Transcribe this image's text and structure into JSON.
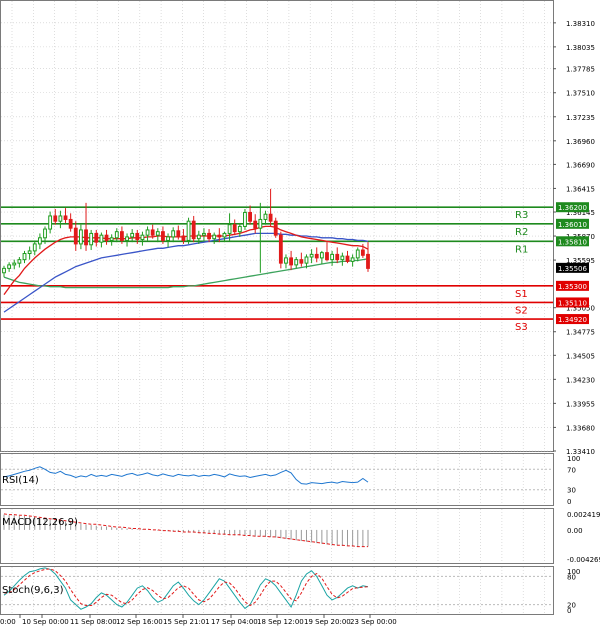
{
  "chart_data": [
    {
      "type": "candlestick",
      "pane": "main",
      "ylim": [
        1.3341,
        1.3856
      ],
      "y_ticks": [
        "1.38310",
        "1.38035",
        "1.37785",
        "1.37510",
        "1.37235",
        "1.36960",
        "1.36690",
        "1.36415",
        "1.36145",
        "1.35870",
        "1.35595",
        "1.35050",
        "1.34775",
        "1.34505",
        "1.34230",
        "1.33955",
        "1.33680",
        "1.33410"
      ],
      "current_price": "1.35506",
      "levels": [
        {
          "label": "R3",
          "value": 1.362,
          "text": "1.36200",
          "color": "#1e8a1e"
        },
        {
          "label": "R2",
          "value": 1.3601,
          "text": "1.36010",
          "color": "#1e8a1e"
        },
        {
          "label": "R1",
          "value": 1.3581,
          "text": "1.35810",
          "color": "#1e8a1e"
        },
        {
          "label": "S1",
          "value": 1.353,
          "text": "1.35300",
          "color": "#e00000"
        },
        {
          "label": "S2",
          "value": 1.3511,
          "text": "1.35110",
          "color": "#e00000"
        },
        {
          "label": "S3",
          "value": 1.3492,
          "text": "1.34920",
          "color": "#e00000"
        }
      ],
      "candles": [
        [
          1.3545,
          1.3553,
          1.354,
          1.355
        ],
        [
          1.355,
          1.3557,
          1.3546,
          1.3554
        ],
        [
          1.3554,
          1.356,
          1.3549,
          1.3556
        ],
        [
          1.3556,
          1.3563,
          1.3551,
          1.356
        ],
        [
          1.356,
          1.357,
          1.3556,
          1.3567
        ],
        [
          1.3567,
          1.3575,
          1.356,
          1.357
        ],
        [
          1.357,
          1.3582,
          1.3565,
          1.3578
        ],
        [
          1.3578,
          1.359,
          1.3572,
          1.3585
        ],
        [
          1.3585,
          1.3598,
          1.3578,
          1.3595
        ],
        [
          1.3595,
          1.3615,
          1.359,
          1.361
        ],
        [
          1.361,
          1.3618,
          1.36,
          1.3604
        ],
        [
          1.3604,
          1.3616,
          1.3596,
          1.361
        ],
        [
          1.361,
          1.3619,
          1.3602,
          1.3606
        ],
        [
          1.3606,
          1.3613,
          1.3592,
          1.3596
        ],
        [
          1.3596,
          1.3604,
          1.357,
          1.3578
        ],
        [
          1.3578,
          1.36,
          1.3572,
          1.3594
        ],
        [
          1.3594,
          1.3625,
          1.357,
          1.3577
        ],
        [
          1.3577,
          1.3594,
          1.3571,
          1.359
        ],
        [
          1.359,
          1.3594,
          1.3575,
          1.358
        ],
        [
          1.358,
          1.3591,
          1.3574,
          1.3588
        ],
        [
          1.3588,
          1.3594,
          1.3577,
          1.3582
        ],
        [
          1.3582,
          1.3589,
          1.3576,
          1.3585
        ],
        [
          1.3585,
          1.3596,
          1.358,
          1.3592
        ],
        [
          1.3592,
          1.3598,
          1.3578,
          1.3582
        ],
        [
          1.3582,
          1.359,
          1.3575,
          1.3586
        ],
        [
          1.3586,
          1.3595,
          1.358,
          1.359
        ],
        [
          1.359,
          1.3594,
          1.3578,
          1.3583
        ],
        [
          1.3583,
          1.3592,
          1.3576,
          1.3588
        ],
        [
          1.3588,
          1.3598,
          1.3582,
          1.3594
        ],
        [
          1.3594,
          1.36,
          1.3584,
          1.3588
        ],
        [
          1.3588,
          1.3596,
          1.358,
          1.3592
        ],
        [
          1.3592,
          1.3598,
          1.3578,
          1.3582
        ],
        [
          1.3582,
          1.359,
          1.3574,
          1.3586
        ],
        [
          1.3586,
          1.3597,
          1.358,
          1.3593
        ],
        [
          1.3593,
          1.3599,
          1.3583,
          1.3587
        ],
        [
          1.3587,
          1.3595,
          1.3578,
          1.3582
        ],
        [
          1.3582,
          1.3608,
          1.3578,
          1.3604
        ],
        [
          1.3604,
          1.361,
          1.358,
          1.3584
        ],
        [
          1.3584,
          1.3593,
          1.3578,
          1.3588
        ],
        [
          1.3588,
          1.3596,
          1.3582,
          1.359
        ],
        [
          1.359,
          1.3595,
          1.358,
          1.3584
        ],
        [
          1.3584,
          1.3591,
          1.3578,
          1.3588
        ],
        [
          1.3588,
          1.3596,
          1.358,
          1.3586
        ],
        [
          1.3586,
          1.3592,
          1.358,
          1.359
        ],
        [
          1.359,
          1.3613,
          1.3582,
          1.36
        ],
        [
          1.36,
          1.3606,
          1.3588,
          1.3592
        ],
        [
          1.3592,
          1.3602,
          1.3586,
          1.3598
        ],
        [
          1.3598,
          1.3618,
          1.3594,
          1.3614
        ],
        [
          1.3614,
          1.3622,
          1.36,
          1.3604
        ],
        [
          1.3604,
          1.3612,
          1.359,
          1.3596
        ],
        [
          1.3596,
          1.3625,
          1.3545,
          1.3606
        ],
        [
          1.3606,
          1.3616,
          1.36,
          1.3612
        ],
        [
          1.3612,
          1.3641,
          1.3598,
          1.3604
        ],
        [
          1.3604,
          1.3608,
          1.3585,
          1.3588
        ],
        [
          1.3588,
          1.3592,
          1.355,
          1.3556
        ],
        [
          1.3556,
          1.3566,
          1.355,
          1.3562
        ],
        [
          1.3562,
          1.357,
          1.3548,
          1.3554
        ],
        [
          1.3554,
          1.3563,
          1.355,
          1.356
        ],
        [
          1.356,
          1.3568,
          1.3552,
          1.3556
        ],
        [
          1.3556,
          1.3566,
          1.355,
          1.3563
        ],
        [
          1.3563,
          1.3572,
          1.3556,
          1.3566
        ],
        [
          1.3566,
          1.3574,
          1.3557,
          1.3562
        ],
        [
          1.3562,
          1.357,
          1.3555,
          1.3568
        ],
        [
          1.3568,
          1.358,
          1.3558,
          1.356
        ],
        [
          1.356,
          1.357,
          1.3553,
          1.3566
        ],
        [
          1.3566,
          1.3574,
          1.3556,
          1.356
        ],
        [
          1.356,
          1.3568,
          1.3553,
          1.3564
        ],
        [
          1.3564,
          1.357,
          1.3556,
          1.3558
        ],
        [
          1.3558,
          1.3566,
          1.3552,
          1.3562
        ],
        [
          1.3562,
          1.3574,
          1.3558,
          1.3571
        ],
        [
          1.3571,
          1.3578,
          1.3562,
          1.3565
        ],
        [
          1.3566,
          1.358,
          1.3546,
          1.355
        ]
      ],
      "ma_red": [
        1.352,
        1.3528,
        1.3536,
        1.3542,
        1.355,
        1.3556,
        1.3562,
        1.3567,
        1.3572,
        1.3576,
        1.358,
        1.3583,
        1.3585,
        1.3586,
        1.3586,
        1.3586,
        1.3585,
        1.3585,
        1.3585,
        1.3585,
        1.3584,
        1.3584,
        1.3584,
        1.3584,
        1.3584,
        1.3585,
        1.3585,
        1.3585,
        1.3586,
        1.3586,
        1.3587,
        1.3587,
        1.3586,
        1.3586,
        1.3586,
        1.3586,
        1.3587,
        1.3587,
        1.3587,
        1.3587,
        1.3587,
        1.3587,
        1.3587,
        1.3587,
        1.3588,
        1.3589,
        1.359,
        1.3592,
        1.3594,
        1.3595,
        1.3597,
        1.3598,
        1.3598,
        1.3597,
        1.3594,
        1.3592,
        1.359,
        1.3588,
        1.3586,
        1.3585,
        1.3584,
        1.3583,
        1.3582,
        1.3581,
        1.358,
        1.3579,
        1.3578,
        1.3577,
        1.3576,
        1.3576,
        1.3575,
        1.3572
      ],
      "ma_blue": [
        1.35,
        1.3504,
        1.3508,
        1.3512,
        1.3516,
        1.352,
        1.3524,
        1.3528,
        1.3532,
        1.3536,
        1.354,
        1.3543,
        1.3546,
        1.3549,
        1.3552,
        1.3554,
        1.3556,
        1.3558,
        1.356,
        1.3562,
        1.3563,
        1.3564,
        1.3565,
        1.3566,
        1.3567,
        1.3568,
        1.3569,
        1.357,
        1.3571,
        1.3572,
        1.3573,
        1.3573,
        1.3574,
        1.3575,
        1.3576,
        1.3576,
        1.3577,
        1.3578,
        1.3579,
        1.358,
        1.3581,
        1.3582,
        1.3583,
        1.3584,
        1.3585,
        1.3586,
        1.3587,
        1.3588,
        1.3589,
        1.359,
        1.359,
        1.359,
        1.359,
        1.359,
        1.3589,
        1.3589,
        1.3588,
        1.3588,
        1.3587,
        1.3587,
        1.3586,
        1.3586,
        1.3585,
        1.3585,
        1.3585,
        1.3584,
        1.3584,
        1.3583,
        1.3583,
        1.3582,
        1.3582,
        1.3581
      ],
      "ma_green": [
        1.354,
        1.3538,
        1.3536,
        1.3534,
        1.3533,
        1.3532,
        1.3531,
        1.353,
        1.353,
        1.3529,
        1.3529,
        1.3529,
        1.3528,
        1.3528,
        1.3528,
        1.3528,
        1.3528,
        1.3528,
        1.3528,
        1.3528,
        1.3528,
        1.3528,
        1.3528,
        1.3528,
        1.3528,
        1.3528,
        1.3528,
        1.3528,
        1.3528,
        1.3528,
        1.3528,
        1.3528,
        1.3528,
        1.3529,
        1.3529,
        1.3529,
        1.353,
        1.353,
        1.3531,
        1.3532,
        1.3533,
        1.3534,
        1.3535,
        1.3536,
        1.3537,
        1.3538,
        1.3539,
        1.354,
        1.3541,
        1.3542,
        1.3543,
        1.3544,
        1.3545,
        1.3546,
        1.3547,
        1.3548,
        1.3549,
        1.355,
        1.3551,
        1.3552,
        1.3553,
        1.3554,
        1.3555,
        1.3556,
        1.3557,
        1.3557,
        1.3558,
        1.3558,
        1.3559,
        1.3559,
        1.356,
        1.3561
      ]
    },
    {
      "type": "line",
      "pane": "rsi",
      "title": "RSI(14)",
      "ylim": [
        0,
        100
      ],
      "y_ticks": [
        "100",
        "70",
        "30",
        "0"
      ],
      "levels": [
        70,
        30
      ],
      "values": [
        55,
        57,
        60,
        63,
        66,
        68,
        72,
        75,
        70,
        64,
        62,
        66,
        60,
        58,
        54,
        57,
        55,
        60,
        56,
        58,
        56,
        60,
        58,
        56,
        60,
        62,
        58,
        60,
        63,
        59,
        57,
        61,
        58,
        56,
        60,
        58,
        57,
        59,
        56,
        58,
        57,
        60,
        58,
        55,
        61,
        58,
        56,
        57,
        54,
        56,
        58,
        60,
        57,
        59,
        64,
        68,
        63,
        50,
        42,
        41,
        44,
        43,
        42,
        44,
        45,
        43,
        46,
        45,
        44,
        45,
        52,
        45
      ]
    },
    {
      "type": "line",
      "pane": "macd",
      "title": "MACD(12,26,9)",
      "ylim": [
        -0.00475,
        0.003
      ],
      "y_ticks": [
        "0.002419",
        "0.00",
        "-0.004269"
      ],
      "histogram": [
        0.0022,
        0.0021,
        0.0021,
        0.002,
        0.002,
        0.0019,
        0.0018,
        0.0017,
        0.0016,
        0.0015,
        0.0014,
        0.0013,
        0.0012,
        0.0011,
        0.001,
        0.0009,
        0.0008,
        0.0007,
        0.0006,
        0.0005,
        0.0005,
        0.0004,
        0.0003,
        0.0003,
        0.0002,
        0.0002,
        0.0001,
        0.0001,
        0.0,
        0.0,
        -0.0001,
        -0.0001,
        -0.0002,
        -0.0002,
        -0.0003,
        -0.0003,
        -0.0003,
        -0.0004,
        -0.0004,
        -0.0005,
        -0.0005,
        -0.0006,
        -0.0006,
        -0.0007,
        -0.0007,
        -0.0008,
        -0.0008,
        -0.0008,
        -0.0009,
        -0.0009,
        -0.0009,
        -0.001,
        -0.001,
        -0.0011,
        -0.0012,
        -0.0013,
        -0.0014,
        -0.0015,
        -0.0016,
        -0.0017,
        -0.0018,
        -0.0019,
        -0.002,
        -0.0021,
        -0.0022,
        -0.0022,
        -0.0023,
        -0.0023,
        -0.0024,
        -0.0024,
        -0.0024,
        -0.0024
      ],
      "signal": [
        0.0023,
        0.0022,
        0.0022,
        0.0021,
        0.0021,
        0.002,
        0.0019,
        0.0018,
        0.0017,
        0.0016,
        0.0015,
        0.0014,
        0.0013,
        0.0012,
        0.0011,
        0.001,
        0.0009,
        0.0008,
        0.0008,
        0.0007,
        0.0006,
        0.0005,
        0.0004,
        0.0004,
        0.0003,
        0.0002,
        0.0002,
        0.0001,
        0.0001,
        0.0,
        0.0,
        -0.0001,
        -0.0001,
        -0.0002,
        -0.0002,
        -0.0003,
        -0.0003,
        -0.0003,
        -0.0004,
        -0.0004,
        -0.0005,
        -0.0005,
        -0.0006,
        -0.0006,
        -0.0007,
        -0.0007,
        -0.0007,
        -0.0008,
        -0.0008,
        -0.0009,
        -0.0009,
        -0.0009,
        -0.001,
        -0.001,
        -0.0011,
        -0.0012,
        -0.0013,
        -0.0014,
        -0.0015,
        -0.0016,
        -0.0017,
        -0.0018,
        -0.0019,
        -0.002,
        -0.0021,
        -0.0022,
        -0.0022,
        -0.0023,
        -0.0023,
        -0.0024,
        -0.0024,
        -0.0024
      ]
    },
    {
      "type": "line",
      "pane": "stoch",
      "title": "Stoch(9,6,3)",
      "ylim": [
        0,
        100
      ],
      "y_ticks": [
        "100",
        "80",
        "20",
        "0"
      ],
      "levels": [
        80,
        20
      ],
      "main": [
        40,
        48,
        60,
        72,
        82,
        90,
        92,
        96,
        98,
        95,
        85,
        70,
        55,
        30,
        20,
        10,
        15,
        22,
        35,
        45,
        40,
        30,
        20,
        15,
        25,
        40,
        55,
        60,
        50,
        35,
        25,
        30,
        45,
        60,
        68,
        55,
        40,
        28,
        20,
        30,
        45,
        60,
        75,
        70,
        55,
        40,
        25,
        12,
        20,
        40,
        62,
        75,
        70,
        60,
        45,
        30,
        15,
        40,
        70,
        85,
        92,
        80,
        60,
        40,
        30,
        35,
        45,
        55,
        60,
        55,
        60,
        58
      ],
      "signal": [
        45,
        45,
        52,
        62,
        72,
        82,
        88,
        92,
        95,
        96,
        92,
        82,
        70,
        52,
        36,
        22,
        18,
        18,
        25,
        35,
        42,
        40,
        32,
        24,
        22,
        30,
        42,
        52,
        56,
        50,
        40,
        32,
        35,
        45,
        56,
        60,
        55,
        42,
        30,
        26,
        32,
        44,
        58,
        68,
        66,
        55,
        40,
        26,
        18,
        25,
        40,
        58,
        70,
        70,
        60,
        46,
        32,
        28,
        45,
        66,
        80,
        86,
        76,
        58,
        42,
        34,
        38,
        46,
        54,
        56,
        57,
        58
      ]
    }
  ],
  "x_labels": [
    "0:00",
    "10 Sep 00:00",
    "11 Sep 08:00",
    "12 Sep 16:00",
    "15 Sep 21:01",
    "17 Sep 04:00",
    "18 Sep 12:00",
    "19 Sep 20:00",
    "23 Sep 00:00"
  ],
  "colors": {
    "bull": "#1f9d1f",
    "bear": "#e11a1a",
    "ma_red": "#e11a1a",
    "ma_blue": "#3a55c8",
    "ma_green": "#3ca35c",
    "rsi": "#1f77d0",
    "macd_hist": "#9a9a9a",
    "macd_signal": "#e11a1a",
    "stoch_main": "#1aa4a4",
    "stoch_signal": "#e11a1a"
  }
}
